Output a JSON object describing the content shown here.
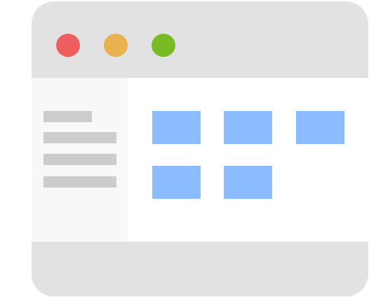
{
  "window": {
    "frame_color": "#e2e2e2",
    "titlebar": {
      "buttons": [
        {
          "name": "close",
          "color": "#ef5e5e"
        },
        {
          "name": "minimize",
          "color": "#e8b24f"
        },
        {
          "name": "maximize",
          "color": "#7aba25"
        }
      ]
    },
    "sidebar": {
      "background": "#f8f8f8",
      "placeholder_color": "#cccccc",
      "line_count": 4
    },
    "content": {
      "background": "#ffffff",
      "tile_color": "#8bbcff",
      "tile_count": 5
    },
    "footer": {
      "background": "#e2e2e2"
    }
  }
}
